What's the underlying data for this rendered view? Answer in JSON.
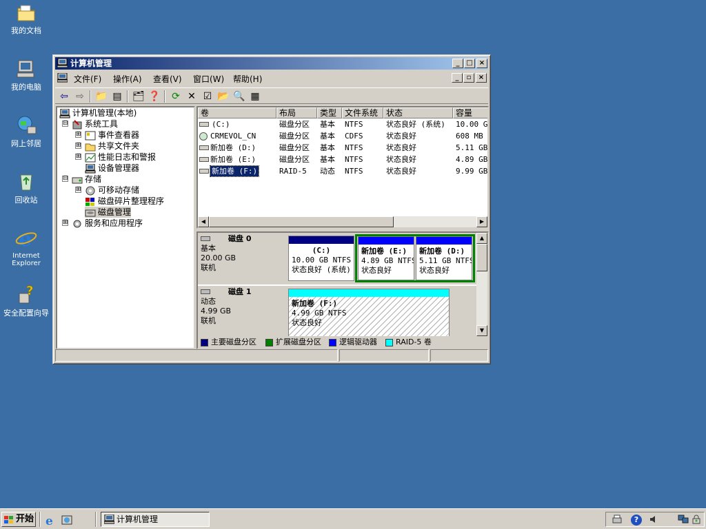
{
  "desktop": {
    "icons": [
      {
        "label": "我的文档"
      },
      {
        "label": "我的电脑"
      },
      {
        "label": "网上邻居"
      },
      {
        "label": "回收站"
      },
      {
        "label": "Internet Explorer"
      },
      {
        "label": "安全配置向导"
      }
    ]
  },
  "window": {
    "title": "计算机管理",
    "menu": [
      "文件(F)",
      "操作(A)",
      "查看(V)",
      "窗口(W)",
      "帮助(H)"
    ]
  },
  "tree": {
    "root": "计算机管理(本地)",
    "items": [
      {
        "label": "系统工具",
        "expander": "⊟"
      },
      {
        "label": "事件查看器",
        "expander": "⊞"
      },
      {
        "label": "共享文件夹",
        "expander": "⊞"
      },
      {
        "label": "性能日志和警报",
        "expander": "⊞"
      },
      {
        "label": "设备管理器",
        "expander": ""
      },
      {
        "label": "存储",
        "expander": "⊟"
      },
      {
        "label": "可移动存储",
        "expander": "⊞"
      },
      {
        "label": "磁盘碎片整理程序",
        "expander": ""
      },
      {
        "label": "磁盘管理",
        "expander": ""
      },
      {
        "label": "服务和应用程序",
        "expander": "⊞"
      }
    ]
  },
  "volumes": {
    "headers": [
      "卷",
      "布局",
      "类型",
      "文件系统",
      "状态",
      "容量"
    ],
    "rows": [
      {
        "name": "(C:)",
        "layout": "磁盘分区",
        "type": "基本",
        "fs": "NTFS",
        "status": "状态良好 (系统)",
        "capacity": "10.00 GB"
      },
      {
        "name": "CRMEVOL_CN",
        "layout": "磁盘分区",
        "type": "基本",
        "fs": "CDFS",
        "status": "状态良好",
        "capacity": "608 MB"
      },
      {
        "name": "新加卷 (D:)",
        "layout": "磁盘分区",
        "type": "基本",
        "fs": "NTFS",
        "status": "状态良好",
        "capacity": "5.11 GB"
      },
      {
        "name": "新加卷 (E:)",
        "layout": "磁盘分区",
        "type": "基本",
        "fs": "NTFS",
        "status": "状态良好",
        "capacity": "4.89 GB"
      },
      {
        "name": "新加卷 (F:)",
        "layout": "RAID-5",
        "type": "动态",
        "fs": "NTFS",
        "status": "状态良好",
        "capacity": "9.99 GB"
      }
    ]
  },
  "disks": [
    {
      "name": "磁盘 0",
      "type": "基本",
      "size": "20.00 GB",
      "state": "联机",
      "partitions": [
        {
          "title": "(C:)",
          "info": "10.00 GB NTFS",
          "status": "状态良好 (系统)",
          "color": "#000080"
        },
        {
          "title": "新加卷 (E:)",
          "info": "4.89 GB NTFS",
          "status": "状态良好",
          "color": "#0000ff"
        },
        {
          "title": "新加卷 (D:)",
          "info": "5.11 GB NTFS",
          "status": "状态良好",
          "color": "#0000ff"
        }
      ]
    },
    {
      "name": "磁盘 1",
      "type": "动态",
      "size": "4.99 GB",
      "state": "联机",
      "partitions": [
        {
          "title": "新加卷 (F:)",
          "info": "4.99 GB NTFS",
          "status": "状态良好",
          "color": "#00ffff"
        }
      ]
    }
  ],
  "legend": [
    {
      "label": "主要磁盘分区",
      "color": "#000080"
    },
    {
      "label": "扩展磁盘分区",
      "color": "#008000"
    },
    {
      "label": "逻辑驱动器",
      "color": "#0000ff"
    },
    {
      "label": "RAID-5 卷",
      "color": "#00ffff"
    }
  ],
  "taskbar": {
    "start": "开始",
    "task": "计算机管理"
  }
}
